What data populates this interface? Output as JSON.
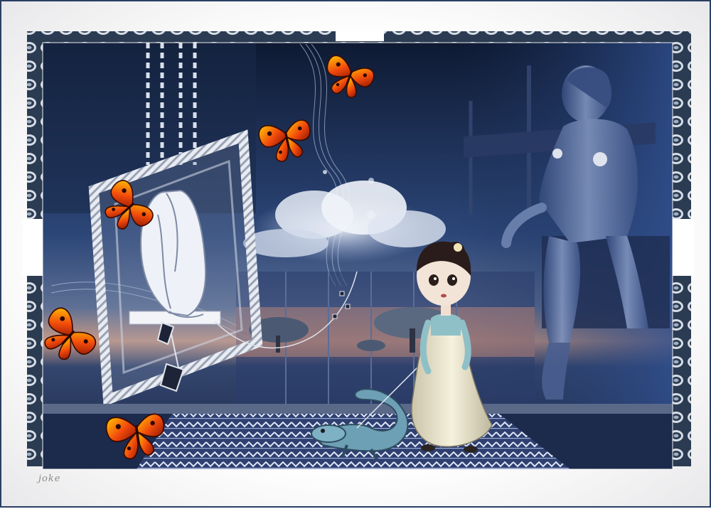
{
  "artwork": {
    "signature": "joke",
    "palette": {
      "background": "#ffffff",
      "border": "#2a3f63",
      "night_sky_dark": "#0e1a33",
      "night_sky_mid": "#2c4678",
      "cloud": "#dfe6f2",
      "butterfly_orange": "#f24a0c",
      "butterfly_yellow": "#ffb400",
      "floor_light": "#c9d3ea",
      "dress": "#efe9d2"
    },
    "elements": [
      "decorative-swirl-border",
      "night-sky",
      "cloud",
      "suspended-frame",
      "sitting-figure",
      "butterfly",
      "girl",
      "blue-lizard",
      "statue-girl",
      "patterned-floor"
    ]
  }
}
